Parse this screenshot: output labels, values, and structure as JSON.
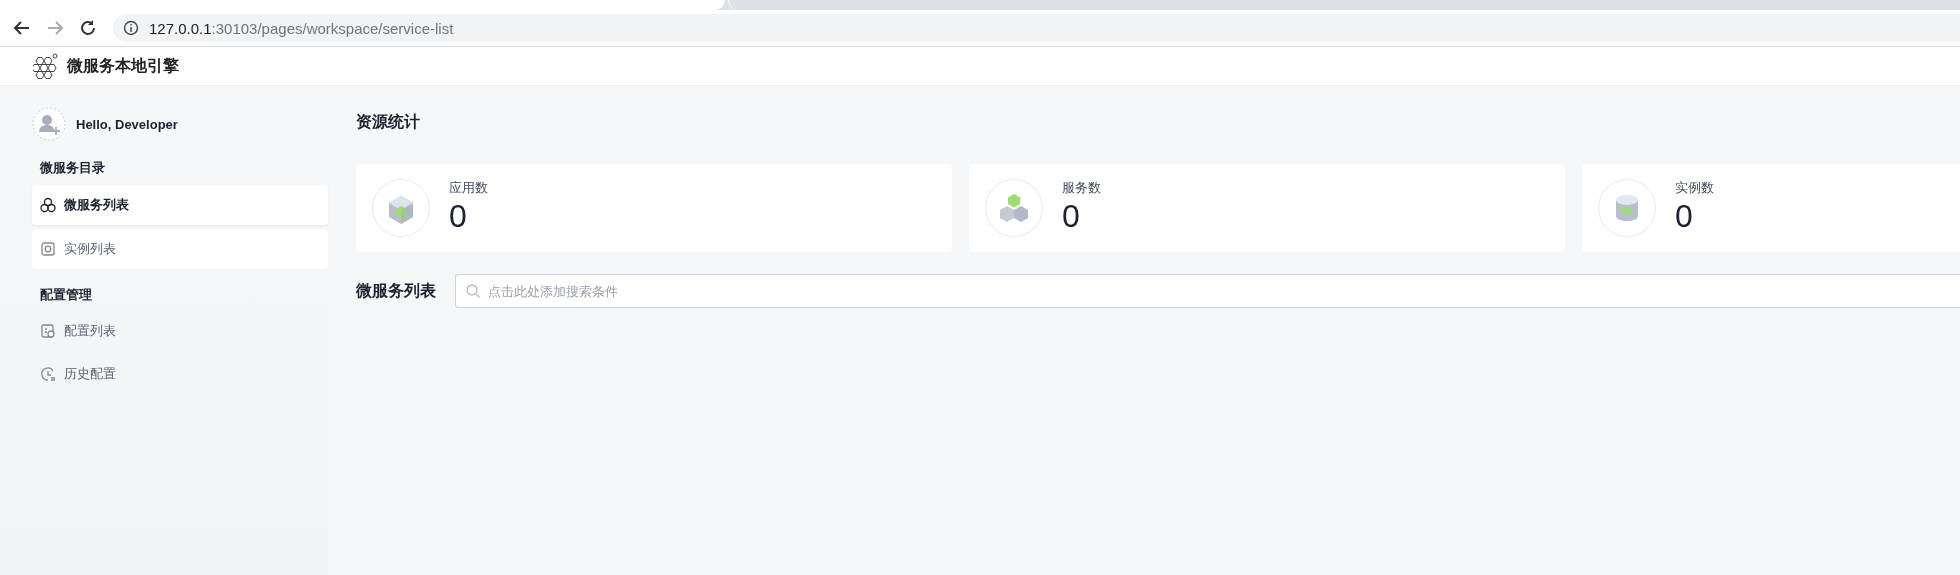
{
  "browser": {
    "address_host": "127.0.0.1",
    "address_path": ":30103/pages/workspace/service-list"
  },
  "app": {
    "title": "微服务本地引擎"
  },
  "user": {
    "greeting": "Hello, Developer"
  },
  "sidebar": {
    "sections": [
      {
        "title": "微服务目录",
        "items": [
          {
            "label": "微服务列表",
            "selected": true
          },
          {
            "label": "实例列表",
            "selected": false
          }
        ]
      },
      {
        "title": "配置管理",
        "items": [
          {
            "label": "配置列表",
            "selected": false
          },
          {
            "label": "历史配置",
            "selected": false
          }
        ]
      }
    ]
  },
  "stats": {
    "title": "资源统计",
    "cards": [
      {
        "label": "应用数",
        "value": "0"
      },
      {
        "label": "服务数",
        "value": "0"
      },
      {
        "label": "实例数",
        "value": "0"
      }
    ]
  },
  "service_list": {
    "title": "微服务列表",
    "search": {
      "placeholder": "点击此处添加搜索条件"
    }
  }
}
